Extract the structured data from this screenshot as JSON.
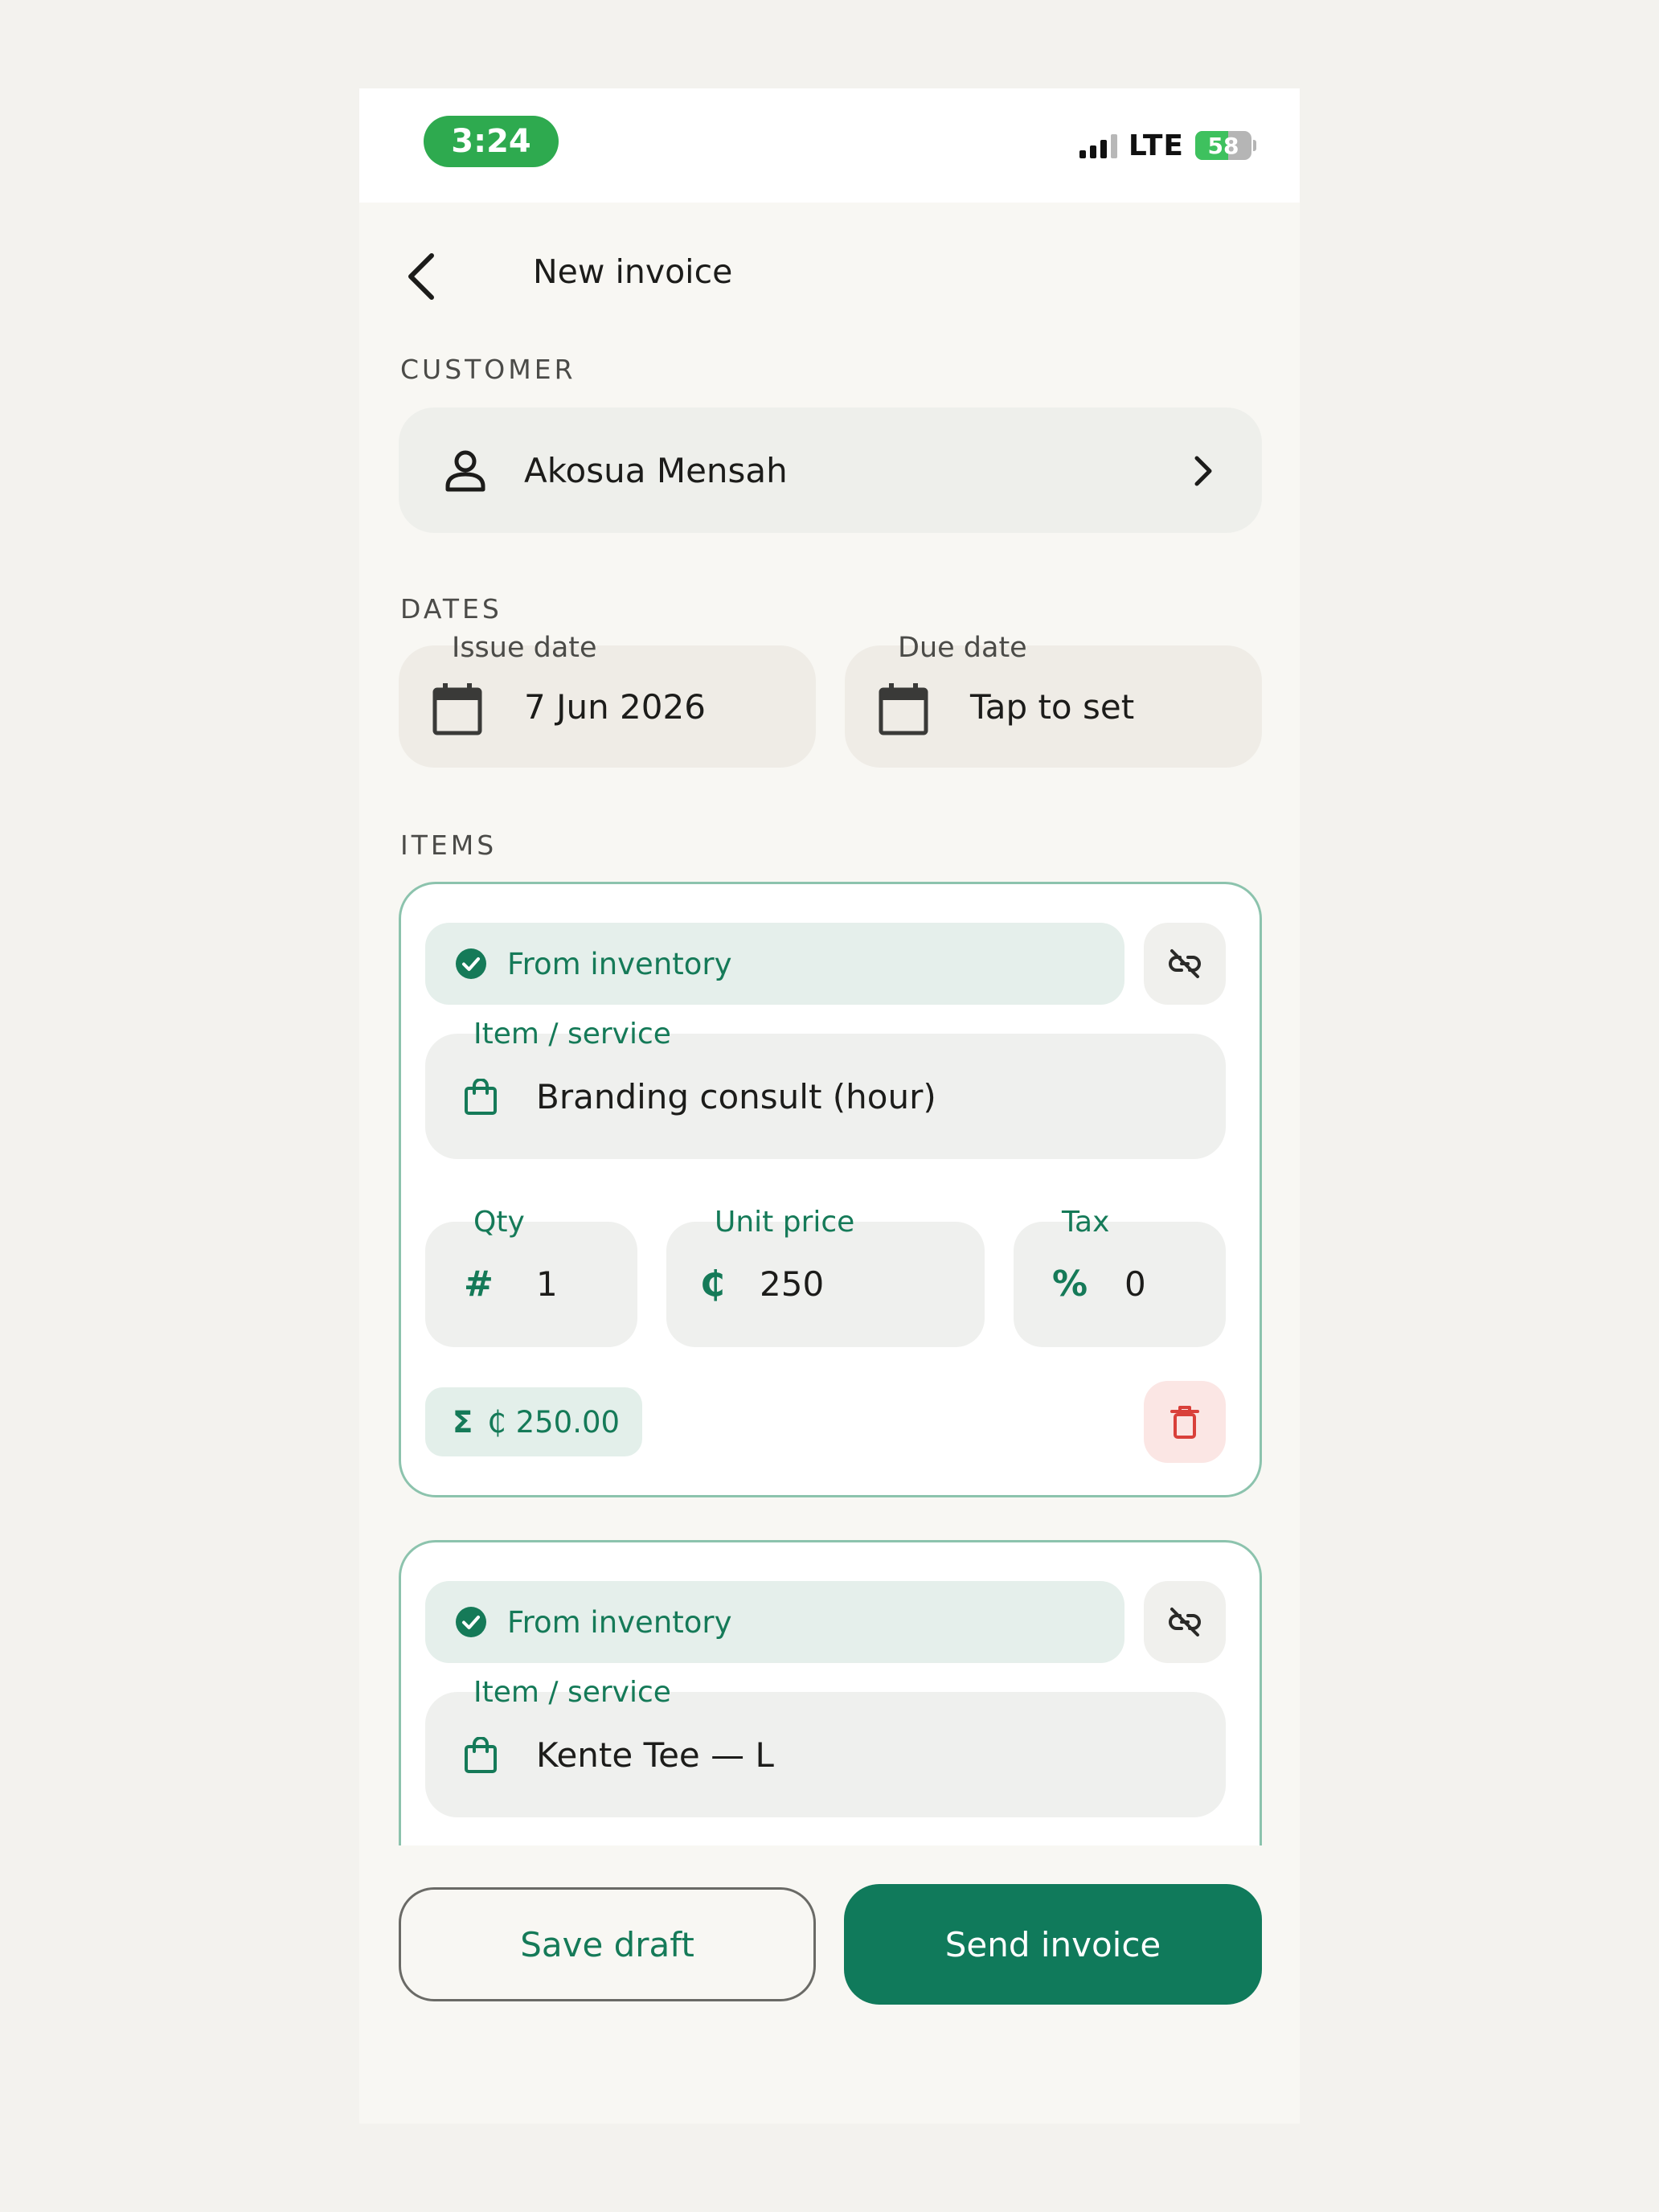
{
  "status_bar": {
    "time": "3:24",
    "network": "LTE",
    "battery": "58",
    "battery_level": 0.58
  },
  "header": {
    "title": "New invoice"
  },
  "customer": {
    "section_label": "CUSTOMER",
    "name": "Akosua Mensah"
  },
  "dates": {
    "section_label": "DATES",
    "issue": {
      "label": "Issue date",
      "value": "7 Jun 2026"
    },
    "due": {
      "label": "Due date",
      "value": "Tap to set"
    }
  },
  "items": {
    "section_label": "ITEMS",
    "list": [
      {
        "badge": "From inventory",
        "item_label": "Item / service",
        "item_value": "Branding consult (hour)",
        "qty_label": "Qty",
        "qty_icon": "#",
        "qty": "1",
        "price_label": "Unit price",
        "price_icon": "₵",
        "price": "250",
        "tax_label": "Tax",
        "tax_icon": "%",
        "tax": "0",
        "total_icon": "Σ",
        "total": "₵ 250.00"
      },
      {
        "badge": "From inventory",
        "item_label": "Item / service",
        "item_value": "Kente Tee — L"
      }
    ]
  },
  "actions": {
    "save_label": "Save draft",
    "send_label": "Send invoice"
  },
  "colors": {
    "accent": "#107a5b",
    "status_pill": "#2eaa4f",
    "danger": "#d9403a"
  }
}
